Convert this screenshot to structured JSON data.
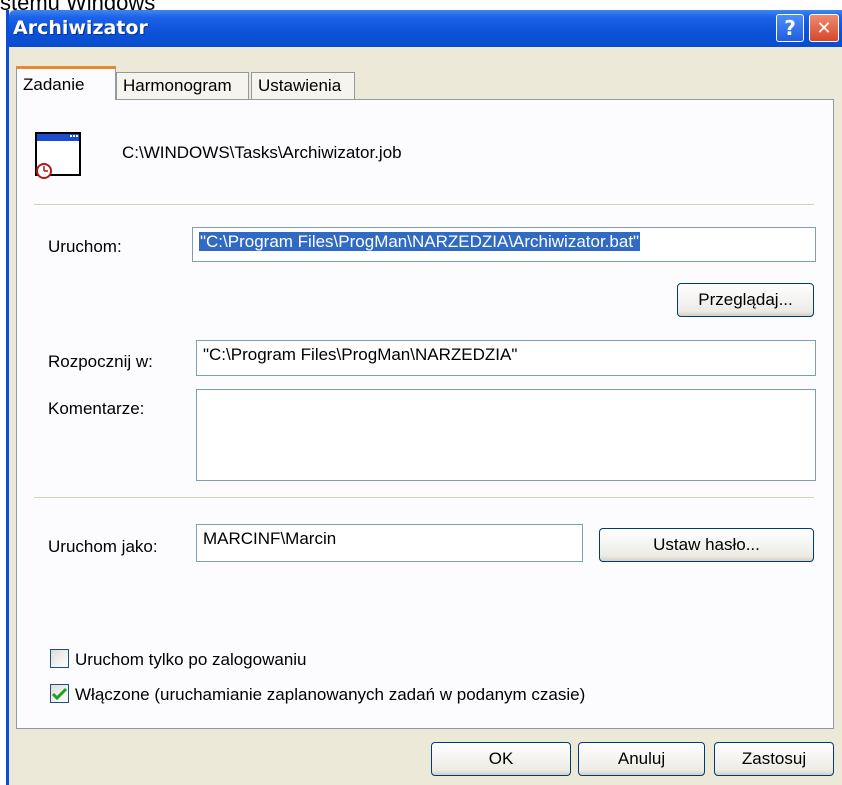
{
  "caption": "stemu Windows",
  "window": {
    "title": "Archiwizator",
    "help_glyph": "?",
    "close_glyph": "✕"
  },
  "tabs": [
    {
      "label": "Zadanie",
      "active": true
    },
    {
      "label": "Harmonogram",
      "active": false
    },
    {
      "label": "Ustawienia",
      "active": false
    }
  ],
  "task": {
    "icon": "scheduled-task-icon",
    "path": "C:\\WINDOWS\\Tasks\\Archiwizator.job"
  },
  "form": {
    "run_label": "Uruchom:",
    "run_value": "\"C:\\Program Files\\ProgMan\\NARZEDZIA\\Archiwizator.bat\"",
    "browse_label": "Przeglądaj...",
    "start_in_label": "Rozpocznij w:",
    "start_in_value": "\"C:\\Program Files\\ProgMan\\NARZEDZIA\"",
    "comments_label": "Komentarze:",
    "comments_value": "",
    "run_as_label": "Uruchom jako:",
    "run_as_value": "MARCINF\\Marcin",
    "set_password_label": "Ustaw hasło..."
  },
  "options": {
    "logged_on_label": "Uruchom tylko po zalogowaniu",
    "logged_on_checked": false,
    "enabled_label": "Włączone (uruchamianie zaplanowanych zadań w podanym czasie)",
    "enabled_checked": true
  },
  "footer": {
    "ok_label": "OK",
    "cancel_label": "Anuluj",
    "apply_label": "Zastosuj"
  },
  "colors": {
    "titlebar": "#0a4ccd",
    "tab_accent": "#e68b2c",
    "selection": "#316ac5",
    "check": "#21a121"
  }
}
